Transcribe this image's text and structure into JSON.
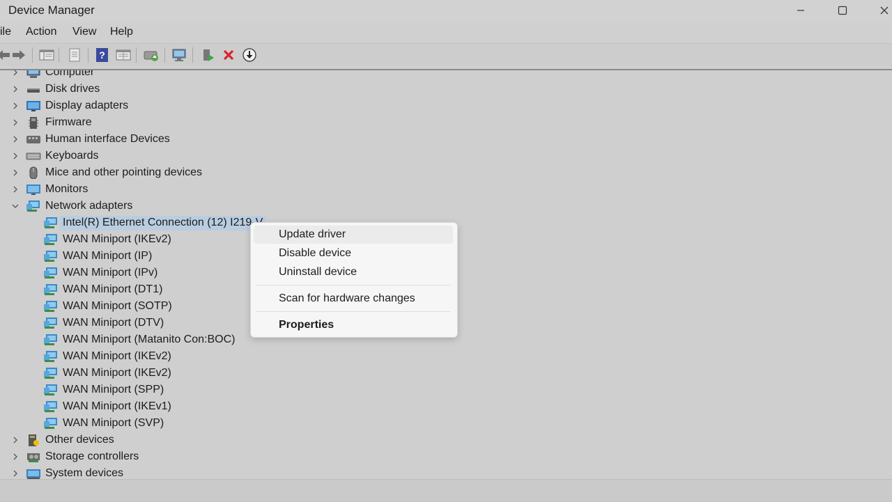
{
  "window": {
    "title": "Device Manager"
  },
  "menubar": {
    "items": [
      "ile",
      "Action",
      "View",
      "Help"
    ]
  },
  "toolbar": {
    "buttons": [
      "back-arrow-icon",
      "forward-arrow-icon",
      "show-hide-tree-icon",
      "properties-sheet-icon",
      "help-icon",
      "view-icon",
      "update-driver-icon",
      "scan-hardware-icon",
      "enable-device-icon",
      "uninstall-device-icon",
      "download-icon"
    ]
  },
  "tree": {
    "categories_top": [
      {
        "label": "Computer",
        "icon": "computer-icon"
      },
      {
        "label": "Disk drives",
        "icon": "disk-drive-icon"
      },
      {
        "label": "Display adapters",
        "icon": "display-adapter-icon"
      },
      {
        "label": "Firmware",
        "icon": "firmware-icon"
      },
      {
        "label": "Human interface Devices",
        "icon": "hid-icon"
      },
      {
        "label": "Keyboards",
        "icon": "keyboard-icon"
      },
      {
        "label": "Mice and other pointing devices",
        "icon": "mouse-icon"
      },
      {
        "label": "Monitors",
        "icon": "monitor-icon"
      },
      {
        "label": "Network adapters",
        "icon": "network-adapter-icon"
      }
    ],
    "network_children": [
      "Intel(R) Ethernet Connection (12) I219-V",
      "WAN Miniport (IKEv2)",
      "WAN Miniport (IP)",
      "WAN Miniport (IPv)",
      "WAN Miniport (DT1)",
      "WAN Miniport (SOTP)",
      "WAN Miniport (DTV)",
      "WAN Miniport (Matanito Con:BOC)",
      "WAN Miniport (IKEv2)",
      "WAN Miniport (IKEv2)",
      "WAN Miniport (SPP)",
      "WAN Miniport (IKEv1)",
      "WAN Miniport (SVP)"
    ],
    "categories_bottom": [
      {
        "label": "Other devices",
        "icon": "other-devices-icon"
      },
      {
        "label": "Storage controllers",
        "icon": "storage-controller-icon"
      },
      {
        "label": "System devices",
        "icon": "system-devices-icon"
      }
    ]
  },
  "context_menu": {
    "items": [
      "Update driver",
      "Disable device",
      "Uninstall device",
      "Scan for hardware changes",
      "Properties"
    ]
  },
  "colors": {
    "background": "#cfcfcf",
    "selection": "#b9cde0",
    "menu_bg": "#f6f6f6",
    "delete_red": "#d9242b"
  }
}
